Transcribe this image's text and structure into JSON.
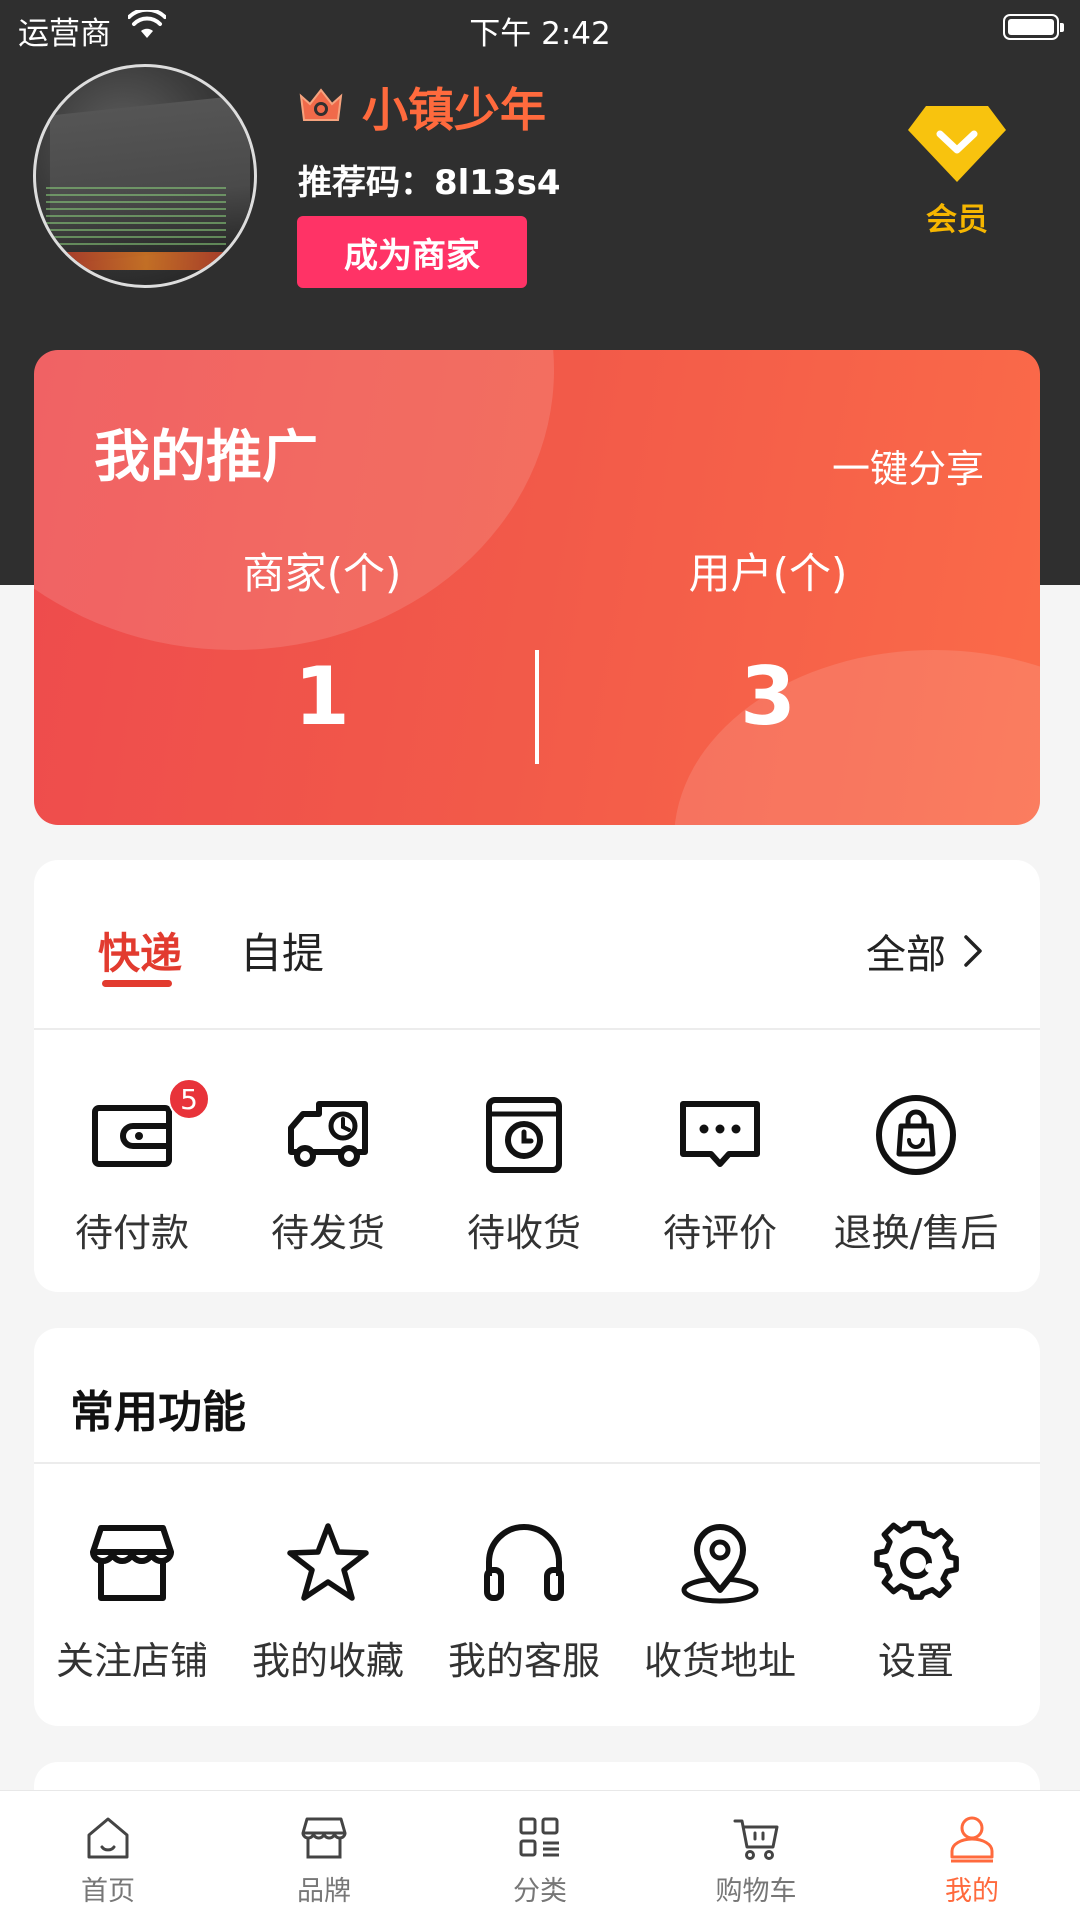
{
  "status_bar": {
    "carrier": "运营商",
    "time": "下午 2:42"
  },
  "profile": {
    "name": "小镇少年",
    "referral": "推荐码：8l13s4",
    "merchant_button": "成为商家",
    "vip_label": "会员"
  },
  "promotion": {
    "title": "我的推广",
    "share": "一键分享",
    "merchants_label": "商家(个)",
    "merchants_value": "1",
    "users_label": "用户(个)",
    "users_value": "3"
  },
  "orders": {
    "tabs": [
      "快递",
      "自提"
    ],
    "all_link": "全部",
    "badge": "5",
    "items": [
      {
        "label": "待付款",
        "icon": "wallet-icon"
      },
      {
        "label": "待发货",
        "icon": "truck-icon"
      },
      {
        "label": "待收货",
        "icon": "package-clock-icon"
      },
      {
        "label": "待评价",
        "icon": "comment-icon"
      },
      {
        "label": "退换/售后",
        "icon": "shopping-bag-icon"
      }
    ]
  },
  "functions": {
    "title": "常用功能",
    "items": [
      {
        "label": "关注店铺",
        "icon": "store-icon"
      },
      {
        "label": "我的收藏",
        "icon": "star-icon"
      },
      {
        "label": "我的客服",
        "icon": "headphones-icon"
      },
      {
        "label": "收货地址",
        "icon": "location-pin-icon"
      },
      {
        "label": "设置",
        "icon": "gear-icon"
      }
    ]
  },
  "tab_bar": {
    "items": [
      {
        "label": "首页",
        "icon": "home-icon"
      },
      {
        "label": "品牌",
        "icon": "brand-store-icon"
      },
      {
        "label": "分类",
        "icon": "category-grid-icon"
      },
      {
        "label": "购物车",
        "icon": "cart-icon"
      },
      {
        "label": "我的",
        "icon": "user-icon"
      }
    ],
    "active": "我的"
  },
  "colors": {
    "accent": "#ff6a3d",
    "header_bg": "#2f2f2f",
    "merchant_button": "#ff3366",
    "vip": "#f6b600",
    "tab_active": "#e23b2f"
  }
}
